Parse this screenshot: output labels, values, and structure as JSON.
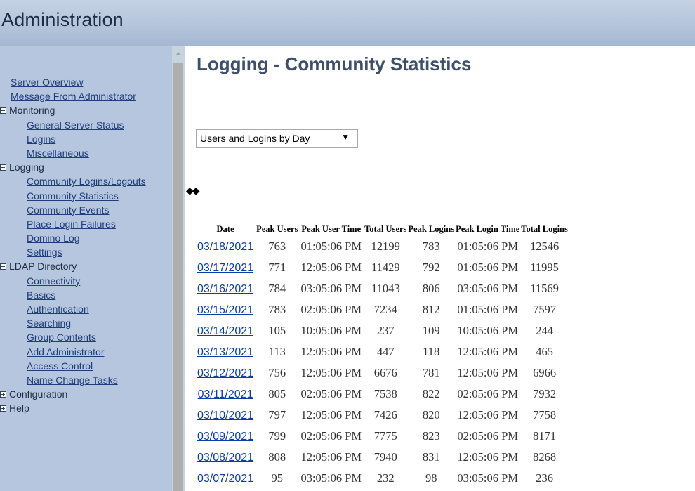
{
  "header": {
    "title": "Administration"
  },
  "sidebar": {
    "items": [
      {
        "label": "Server Overview",
        "type": "link",
        "level": 0
      },
      {
        "label": "Message From Administrator",
        "type": "link",
        "level": 0
      },
      {
        "label": "Monitoring",
        "type": "group",
        "state": "expanded"
      },
      {
        "label": "General Server Status",
        "type": "link",
        "level": 1
      },
      {
        "label": "Logins",
        "type": "link",
        "level": 1
      },
      {
        "label": "Miscellaneous",
        "type": "link",
        "level": 1
      },
      {
        "label": "Logging",
        "type": "group",
        "state": "expanded"
      },
      {
        "label": "Community Logins/Logouts",
        "type": "link",
        "level": 1
      },
      {
        "label": "Community Statistics",
        "type": "link",
        "level": 1
      },
      {
        "label": "Community Events",
        "type": "link",
        "level": 1
      },
      {
        "label": "Place Login Failures",
        "type": "link",
        "level": 1
      },
      {
        "label": "Domino Log",
        "type": "link",
        "level": 1
      },
      {
        "label": "Settings",
        "type": "link",
        "level": 1
      },
      {
        "label": "LDAP Directory",
        "type": "group",
        "state": "expanded"
      },
      {
        "label": "Connectivity",
        "type": "link",
        "level": 1
      },
      {
        "label": "Basics",
        "type": "link",
        "level": 1
      },
      {
        "label": "Authentication",
        "type": "link",
        "level": 1
      },
      {
        "label": "Searching",
        "type": "link",
        "level": 1
      },
      {
        "label": "Group Contents",
        "type": "link",
        "level": 1
      },
      {
        "label": "Add Administrator",
        "type": "link",
        "level": 1
      },
      {
        "label": "Access Control",
        "type": "link",
        "level": 1
      },
      {
        "label": "Name Change Tasks",
        "type": "link",
        "level": 1
      },
      {
        "label": "Configuration",
        "type": "group",
        "state": "collapsed"
      },
      {
        "label": "Help",
        "type": "group",
        "state": "collapsed"
      }
    ]
  },
  "main": {
    "title": "Logging - Community Statistics",
    "view_select": {
      "value": "Users and Logins by Day",
      "caret": "▼"
    },
    "nav_arrows": "◆◆",
    "table": {
      "columns": [
        "Date",
        "Peak Users",
        "Peak User Time",
        "Total Users",
        "Peak Logins",
        "Peak Login Time",
        "Total Logins"
      ],
      "rows": [
        [
          "03/18/2021",
          "763",
          "01:05:06 PM",
          "12199",
          "783",
          "01:05:06 PM",
          "12546"
        ],
        [
          "03/17/2021",
          "771",
          "12:05:06 PM",
          "11429",
          "792",
          "01:05:06 PM",
          "11995"
        ],
        [
          "03/16/2021",
          "784",
          "03:05:06 PM",
          "11043",
          "806",
          "03:05:06 PM",
          "11569"
        ],
        [
          "03/15/2021",
          "783",
          "02:05:06 PM",
          "7234",
          "812",
          "01:05:06 PM",
          "7597"
        ],
        [
          "03/14/2021",
          "105",
          "10:05:06 PM",
          "237",
          "109",
          "10:05:06 PM",
          "244"
        ],
        [
          "03/13/2021",
          "113",
          "12:05:06 PM",
          "447",
          "118",
          "12:05:06 PM",
          "465"
        ],
        [
          "03/12/2021",
          "756",
          "12:05:06 PM",
          "6676",
          "781",
          "12:05:06 PM",
          "6966"
        ],
        [
          "03/11/2021",
          "805",
          "02:05:06 PM",
          "7538",
          "822",
          "02:05:06 PM",
          "7932"
        ],
        [
          "03/10/2021",
          "797",
          "12:05:06 PM",
          "7426",
          "820",
          "12:05:06 PM",
          "7758"
        ],
        [
          "03/09/2021",
          "799",
          "02:05:06 PM",
          "7775",
          "823",
          "02:05:06 PM",
          "8171"
        ],
        [
          "03/08/2021",
          "808",
          "12:05:06 PM",
          "7940",
          "831",
          "12:05:06 PM",
          "8268"
        ],
        [
          "03/07/2021",
          "95",
          "03:05:06 PM",
          "232",
          "98",
          "03:05:06 PM",
          "236"
        ]
      ]
    }
  }
}
